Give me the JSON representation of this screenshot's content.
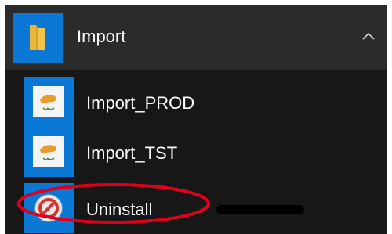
{
  "group": {
    "label": "Import",
    "icon": "folder-icon",
    "expanded": true
  },
  "apps": [
    {
      "label": "Import_PROD",
      "icon": "cyprus-flag-icon"
    },
    {
      "label": "Import_TST",
      "icon": "cyprus-flag-icon"
    },
    {
      "label": "Uninstall",
      "icon": "uninstall-icon"
    }
  ],
  "colors": {
    "menu_background": "#171717",
    "group_header_background": "#2b2b2b",
    "tile_accent": "#0a78d4",
    "annotation": "#e0001b",
    "text": "#ffffff"
  }
}
